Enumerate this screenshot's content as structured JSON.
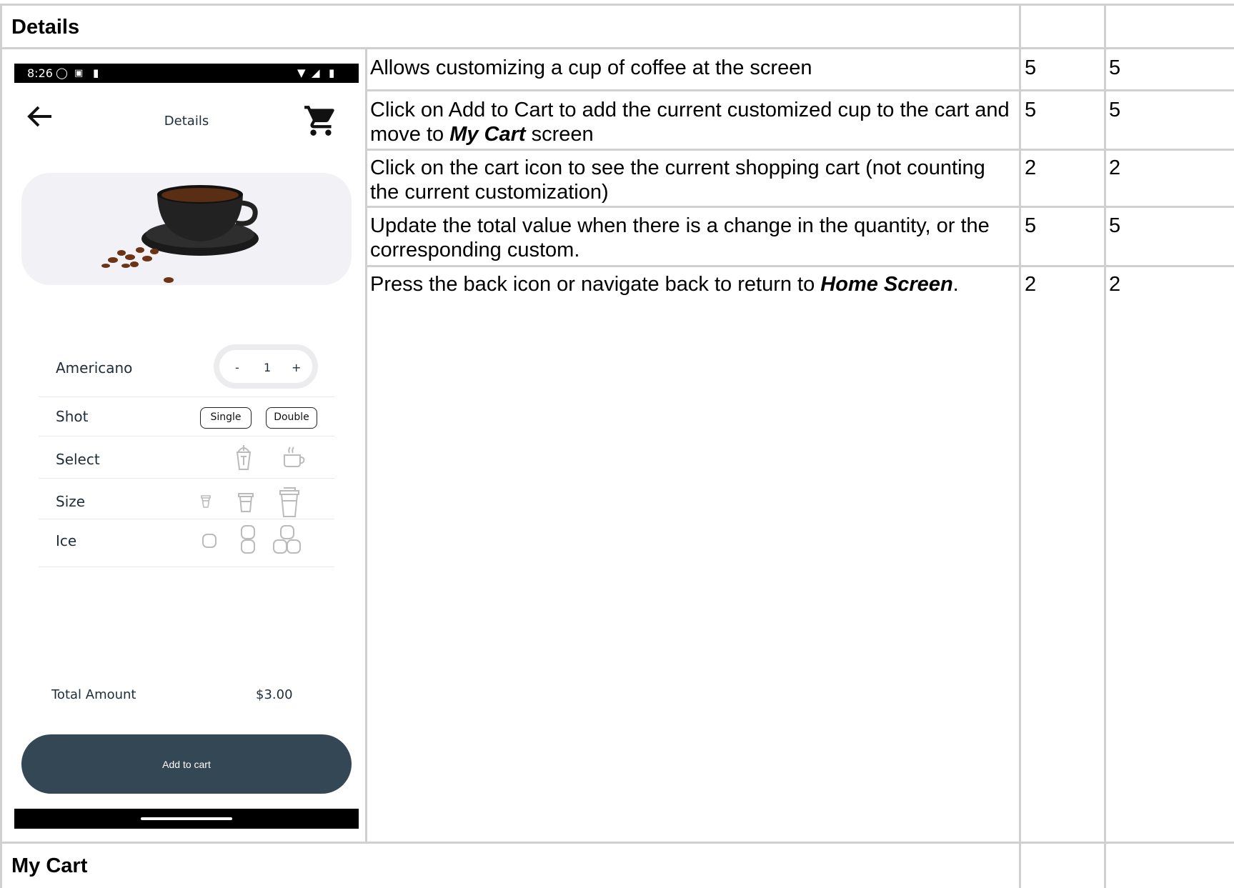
{
  "sections": {
    "details_title": "Details",
    "mycart_title": "My Cart"
  },
  "requirements": [
    {
      "text_html": "Allows customizing a cup of coffee at the screen",
      "score_a": "5",
      "score_b": "5"
    },
    {
      "text_parts": [
        "Click on Add to Cart to add the current customized cup to the cart and move to ",
        "My Cart",
        " screen"
      ],
      "score_a": "5",
      "score_b": "5"
    },
    {
      "text_html": "Click on the cart icon to see the current shopping cart (not counting the current customization)",
      "score_a": "2",
      "score_b": "2"
    },
    {
      "text_html": "Update the total value when there is a change in the quantity, or the corresponding custom.",
      "score_a": "5",
      "score_b": "5"
    },
    {
      "text_parts": [
        "Press the back icon or navigate back to return to ",
        "Home Screen",
        "."
      ],
      "score_a": "2",
      "score_b": "2"
    }
  ],
  "phone": {
    "status_time": "8:26",
    "appbar_title": "Details",
    "product_name": "Americano",
    "quantity": {
      "minus": "-",
      "value": "1",
      "plus": "+"
    },
    "options": {
      "shot_label": "Shot",
      "shot_single": "Single",
      "shot_double": "Double",
      "select_label": "Select",
      "size_label": "Size",
      "ice_label": "Ice"
    },
    "total_label": "Total Amount",
    "total_value": "$3.00",
    "add_button": "Add to cart",
    "icons": [
      "back-arrow-icon",
      "cart-icon",
      "iced-drink-icon",
      "hot-cup-icon",
      "small-cup-icon",
      "medium-cup-icon",
      "large-cup-icon",
      "one-ice-icon",
      "two-ice-icon",
      "three-ice-icon"
    ]
  }
}
